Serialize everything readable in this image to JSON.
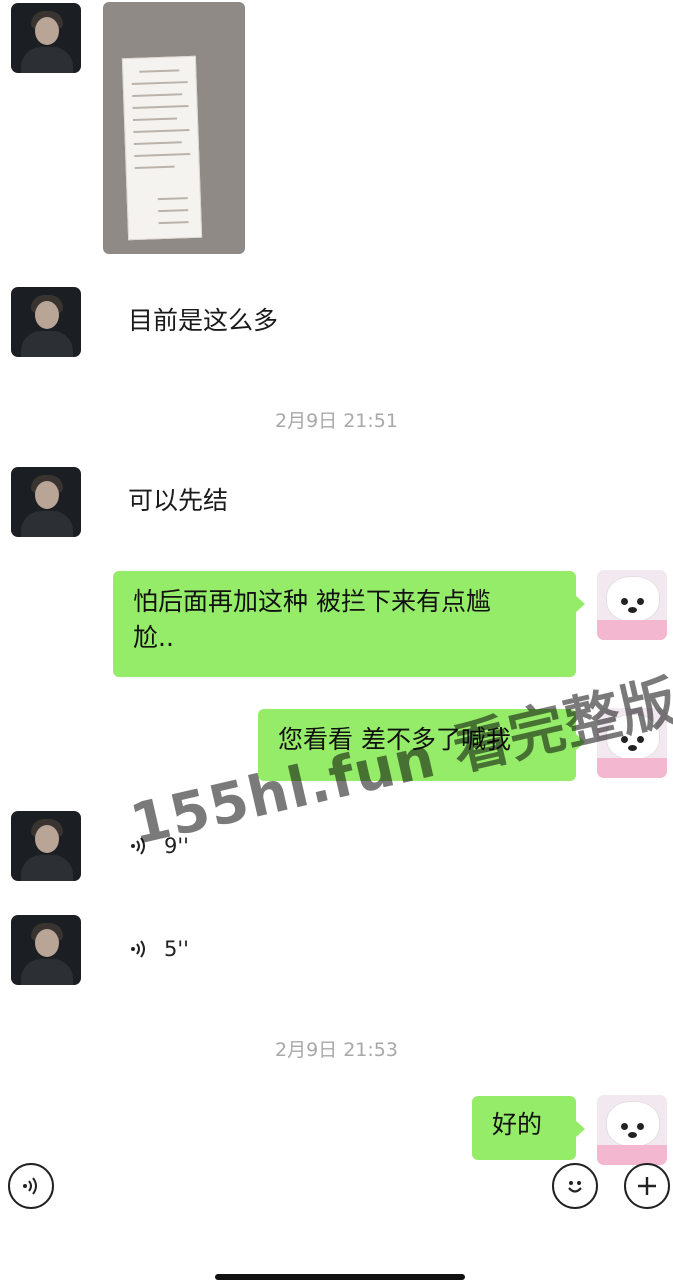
{
  "messages": {
    "text1": "目前是这么多",
    "time1": "2月9日 21:51",
    "text2": "可以先结",
    "bubble1_line1": "怕后面再加这种 被拦下来有点尴",
    "bubble1_line2": "尬..",
    "bubble2": "您看看 差不多了喊我",
    "voice1": "9''",
    "voice2": "5''",
    "time2": "2月9日 21:53",
    "bubble3": "好的"
  },
  "watermark": "155hl.fun 看完整版",
  "icons": {
    "voice_toggle": "voice-icon",
    "emoji": "emoji-icon",
    "plus": "plus-icon"
  },
  "colors": {
    "bubble_green": "#95ec69",
    "time_gray": "#a8a8a8"
  }
}
